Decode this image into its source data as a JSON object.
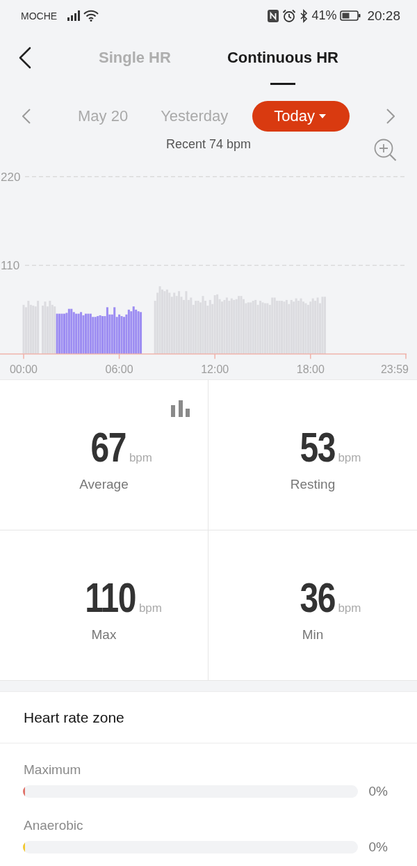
{
  "status_bar": {
    "carrier": "MOCHE",
    "battery": "41%",
    "time": "20:28"
  },
  "header": {
    "tabs": [
      {
        "label": "Single HR",
        "selected": false
      },
      {
        "label": "Continuous HR",
        "selected": true
      }
    ]
  },
  "date_nav": {
    "dates": [
      {
        "label": "May 20",
        "selected": false
      },
      {
        "label": "Yesterday",
        "selected": false
      },
      {
        "label": "Today",
        "selected": true
      }
    ]
  },
  "chart": {
    "recent": "Recent 74 bpm",
    "chart_data": {
      "type": "bar",
      "xlim": [
        0,
        1439
      ],
      "ylim": [
        0,
        220
      ],
      "xticks": [
        {
          "value": 0,
          "label": "00:00"
        },
        {
          "value": 360,
          "label": "06:00"
        },
        {
          "value": 720,
          "label": "12:00"
        },
        {
          "value": 1080,
          "label": "18:00"
        },
        {
          "value": 1439,
          "label": "23:59"
        }
      ],
      "yticks": [
        110,
        220
      ],
      "x": [
        0,
        9,
        18,
        27,
        36,
        45,
        54,
        72,
        81,
        90,
        99,
        108,
        117,
        126,
        135,
        144,
        153,
        162,
        171,
        180,
        189,
        198,
        207,
        216,
        225,
        234,
        243,
        252,
        261,
        270,
        279,
        288,
        297,
        306,
        315,
        324,
        333,
        342,
        351,
        360,
        369,
        378,
        387,
        396,
        405,
        414,
        423,
        432,
        441,
        495,
        504,
        513,
        522,
        531,
        540,
        549,
        558,
        567,
        576,
        585,
        594,
        603,
        612,
        621,
        630,
        639,
        648,
        657,
        666,
        675,
        684,
        693,
        702,
        711,
        720,
        729,
        738,
        747,
        756,
        765,
        774,
        783,
        792,
        801,
        810,
        819,
        828,
        837,
        846,
        855,
        864,
        873,
        882,
        891,
        900,
        909,
        918,
        927,
        936,
        945,
        954,
        963,
        972,
        981,
        990,
        999,
        1008,
        1017,
        1026,
        1035,
        1044,
        1053,
        1062,
        1071,
        1080,
        1089,
        1098,
        1107,
        1116,
        1125,
        1134
      ],
      "series": [
        {
          "color": "#dcdce0",
          "values": [
            61,
            58,
            66,
            61,
            60,
            59,
            66,
            60,
            65,
            59,
            66,
            61,
            59,
            null,
            null,
            null,
            null,
            null,
            null,
            null,
            null,
            null,
            null,
            null,
            null,
            null,
            null,
            null,
            null,
            null,
            null,
            null,
            null,
            null,
            null,
            null,
            null,
            null,
            null,
            null,
            null,
            null,
            null,
            null,
            null,
            null,
            null,
            null,
            null,
            66,
            76,
            84,
            80,
            78,
            80,
            76,
            71,
            76,
            72,
            78,
            71,
            67,
            78,
            67,
            70,
            61,
            66,
            66,
            64,
            72,
            66,
            60,
            67,
            62,
            73,
            74,
            68,
            65,
            67,
            70,
            66,
            69,
            67,
            68,
            72,
            72,
            68,
            63,
            64,
            64,
            66,
            67,
            61,
            66,
            64,
            63,
            63,
            61,
            70,
            70,
            66,
            66,
            66,
            65,
            67,
            62,
            67,
            65,
            69,
            66,
            69,
            65,
            63,
            61,
            65,
            69,
            66,
            70,
            63,
            71,
            71
          ]
        },
        {
          "color": "#9c8cf2",
          "values": [
            null,
            null,
            null,
            null,
            null,
            null,
            null,
            null,
            null,
            null,
            null,
            null,
            null,
            50,
            50,
            50,
            50,
            51,
            56,
            56,
            52,
            50,
            50,
            52,
            48,
            50,
            50,
            50,
            46,
            46,
            47,
            48,
            47,
            47,
            58,
            49,
            49,
            58,
            46,
            49,
            47,
            46,
            49,
            55,
            53,
            59,
            55,
            53,
            52,
            null,
            null,
            null,
            null,
            null,
            null,
            null,
            null,
            null,
            null,
            null,
            null,
            null,
            null,
            null,
            null,
            null,
            null,
            null,
            null,
            null,
            null,
            null,
            null,
            null,
            null,
            null,
            null,
            null,
            null,
            null,
            null,
            null,
            null,
            null,
            null,
            null,
            null,
            null,
            null,
            null,
            null,
            null,
            null,
            null,
            null,
            null,
            null,
            null,
            null,
            null,
            null,
            null,
            null,
            null,
            null,
            null,
            null,
            null,
            null,
            null,
            null,
            null,
            null,
            null,
            null,
            null,
            null,
            null,
            null,
            null,
            null
          ]
        }
      ]
    }
  },
  "stats": [
    {
      "value": "67",
      "unit": "bpm",
      "label": "Average"
    },
    {
      "value": "53",
      "unit": "bpm",
      "label": "Resting"
    },
    {
      "value": "110",
      "unit": "bpm",
      "label": "Max"
    },
    {
      "value": "36",
      "unit": "bpm",
      "label": "Min"
    }
  ],
  "heart_rate_zone": {
    "title": "Heart rate zone",
    "zones": [
      {
        "name": "Maximum",
        "level": 0,
        "color": "#e0736a",
        "reading": "0%"
      },
      {
        "name": "Anaerobic",
        "level": 0,
        "color": "#f2c830",
        "reading": "0%"
      }
    ]
  }
}
